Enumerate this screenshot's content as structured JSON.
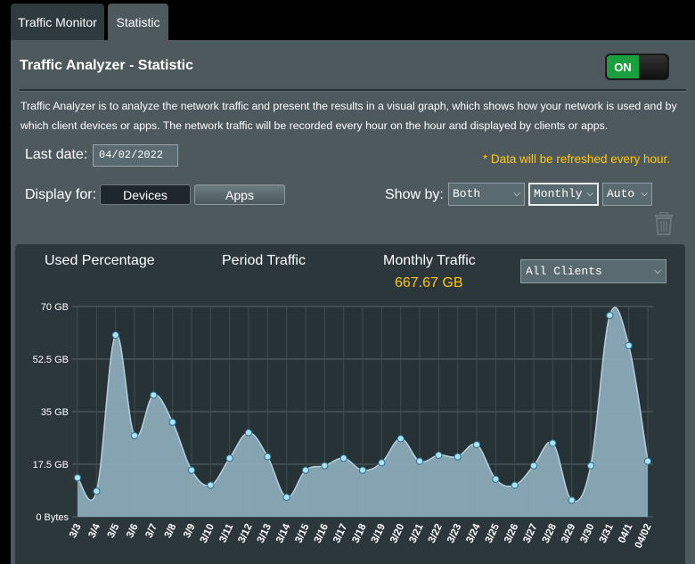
{
  "tabs": [
    {
      "label": "Traffic Monitor"
    },
    {
      "label": "Statistic"
    }
  ],
  "panel": {
    "title": "Traffic Analyzer - Statistic",
    "toggle_label": "ON",
    "description": "Traffic Analyzer is to analyze the network traffic and present the results in a visual graph, which shows how your network is used and by which client devices or apps. The network traffic will be recorded every hour on the hour and displayed by clients or apps."
  },
  "controls": {
    "last_date_label": "Last date:",
    "last_date_value": "04/02/2022",
    "refresh_note": "* Data will be refreshed every hour.",
    "display_for_label": "Display for:",
    "devices_label": "Devices",
    "apps_label": "Apps",
    "show_by_label": "Show by:",
    "both_value": "Both",
    "monthly_value": "Monthly",
    "auto_value": "Auto"
  },
  "chart_header": {
    "used_percentage": "Used Percentage",
    "period_traffic": "Period Traffic",
    "monthly_traffic": "Monthly Traffic",
    "monthly_traffic_value": "667.67 GB",
    "clients_value": "All Clients"
  },
  "colors": {
    "area_fill": "#8dadbb",
    "line": "#b4d0dc",
    "point": "#a9e3f7",
    "accent_yellow": "#ffc60a"
  },
  "chart_data": {
    "type": "area",
    "x": [
      "3/3",
      "3/4",
      "3/5",
      "3/6",
      "3/7",
      "3/8",
      "3/9",
      "3/10",
      "3/11",
      "3/12",
      "3/13",
      "3/14",
      "3/15",
      "3/16",
      "3/17",
      "3/18",
      "3/19",
      "3/20",
      "3/21",
      "3/22",
      "3/23",
      "3/24",
      "3/25",
      "3/26",
      "3/27",
      "3/28",
      "3/29",
      "3/30",
      "3/31",
      "04/1",
      "04/02"
    ],
    "series": [
      {
        "values": [
          13,
          8.5,
          60.5,
          27,
          40.5,
          31.5,
          15.5,
          10.5,
          19.5,
          28,
          20,
          6.5,
          15.5,
          17,
          19.5,
          15.5,
          18,
          26,
          18.5,
          20.5,
          20,
          24,
          12.5,
          10.5,
          17,
          24.5,
          5.5,
          17,
          67,
          57,
          18.5
        ]
      }
    ],
    "y_ticks": [
      "0 Bytes",
      "17.5 GB",
      "35 GB",
      "52.5 GB",
      "70 GB"
    ],
    "ylim": [
      0,
      70
    ],
    "grid": true
  }
}
